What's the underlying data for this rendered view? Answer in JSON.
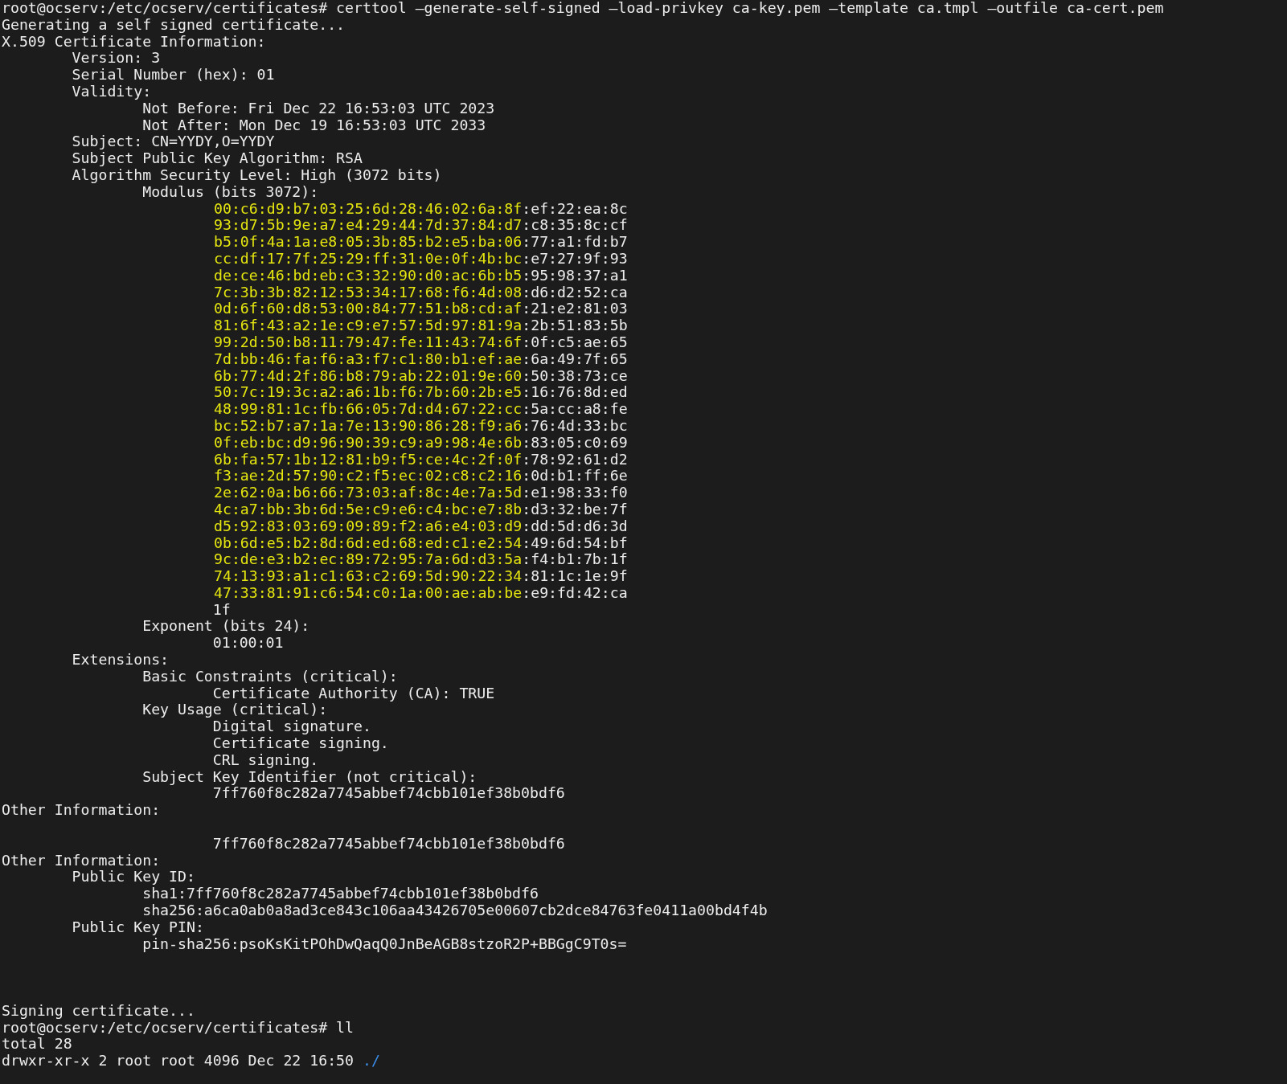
{
  "terminal": {
    "lines": [
      {
        "kind": "command",
        "text": "root@ocserv:/etc/ocserv/certificates# certtool —generate-self-signed —load-privkey ca-key.pem —template ca.tmpl —outfile ca-cert.pem"
      },
      {
        "kind": "output",
        "text": "Generating a self signed certificate..."
      },
      {
        "kind": "output",
        "text": "X.509 Certificate Information:"
      },
      {
        "kind": "output",
        "text": "\tVersion: 3"
      },
      {
        "kind": "output",
        "text": "\tSerial Number (hex): 01"
      },
      {
        "kind": "output",
        "text": "\tValidity:"
      },
      {
        "kind": "output",
        "text": "\t\tNot Before: Fri Dec 22 16:53:03 UTC 2023"
      },
      {
        "kind": "output",
        "text": "\t\tNot After: Mon Dec 19 16:53:03 UTC 2033"
      },
      {
        "kind": "output",
        "text": "\tSubject: CN=YYDY,O=YYDY"
      },
      {
        "kind": "output",
        "text": "\tSubject Public Key Algorithm: RSA"
      },
      {
        "kind": "output",
        "text": "\tAlgorithm Security Level: High (3072 bits)"
      },
      {
        "kind": "output",
        "text": "\t\tModulus (bits 3072):"
      },
      {
        "kind": "hex",
        "highlighted": "00:c6:d9:b7:03:25:6d:28:46:02:6a:8f",
        "rest": ":ef:22:ea:8c"
      },
      {
        "kind": "hex",
        "highlighted": "93:d7:5b:9e:a7:e4:29:44:7d:37:84:d7",
        "rest": ":c8:35:8c:cf"
      },
      {
        "kind": "hex",
        "highlighted": "b5:0f:4a:1a:e8:05:3b:85:b2:e5:ba:06",
        "rest": ":77:a1:fd:b7"
      },
      {
        "kind": "hex",
        "highlighted": "cc:df:17:7f:25:29:ff:31:0e:0f:4b:bc",
        "rest": ":e7:27:9f:93"
      },
      {
        "kind": "hex",
        "highlighted": "de:ce:46:bd:eb:c3:32:90:d0:ac:6b:b5",
        "rest": ":95:98:37:a1"
      },
      {
        "kind": "hex",
        "highlighted": "7c:3b:3b:82:12:53:34:17:68:f6:4d:08",
        "rest": ":d6:d2:52:ca"
      },
      {
        "kind": "hex",
        "highlighted": "0d:6f:60:d8:53:00:84:77:51:b8:cd:af",
        "rest": ":21:e2:81:03"
      },
      {
        "kind": "hex",
        "highlighted": "81:6f:43:a2:1e:c9:e7:57:5d:97:81:9a",
        "rest": ":2b:51:83:5b"
      },
      {
        "kind": "hex",
        "highlighted": "99:2d:50:b8:11:79:47:fe:11:43:74:6f",
        "rest": ":0f:c5:ae:65"
      },
      {
        "kind": "hex",
        "highlighted": "7d:bb:46:fa:f6:a3:f7:c1:80:b1:ef:ae",
        "rest": ":6a:49:7f:65"
      },
      {
        "kind": "hex",
        "highlighted": "6b:77:4d:2f:86:b8:79:ab:22:01:9e:60",
        "rest": ":50:38:73:ce"
      },
      {
        "kind": "hex",
        "highlighted": "50:7c:19:3c:a2:a6:1b:f6:7b:60:2b:e5",
        "rest": ":16:76:8d:ed"
      },
      {
        "kind": "hex",
        "highlighted": "48:99:81:1c:fb:66:05:7d:d4:67:22:cc",
        "rest": ":5a:cc:a8:fe"
      },
      {
        "kind": "hex",
        "highlighted": "bc:52:b7:a7:1a:7e:13:90:86:28:f9:a6",
        "rest": ":76:4d:33:bc"
      },
      {
        "kind": "hex",
        "highlighted": "0f:eb:bc:d9:96:90:39:c9:a9:98:4e:6b",
        "rest": ":83:05:c0:69"
      },
      {
        "kind": "hex",
        "highlighted": "6b:fa:57:1b:12:81:b9:f5:ce:4c:2f:0f",
        "rest": ":78:92:61:d2"
      },
      {
        "kind": "hex",
        "highlighted": "f3:ae:2d:57:90:c2:f5:ec:02:c8:c2:16",
        "rest": ":0d:b1:ff:6e"
      },
      {
        "kind": "hex",
        "highlighted": "2e:62:0a:b6:66:73:03:af:8c:4e:7a:5d",
        "rest": ":e1:98:33:f0"
      },
      {
        "kind": "hex",
        "highlighted": "4c:a7:bb:3b:6d:5e:c9:e6:c4:bc:e7:8b",
        "rest": ":d3:32:be:7f"
      },
      {
        "kind": "hex",
        "highlighted": "d5:92:83:03:69:09:89:f2:a6:e4:03:d9",
        "rest": ":dd:5d:d6:3d"
      },
      {
        "kind": "hex",
        "highlighted": "0b:6d:e5:b2:8d:6d:ed:68:ed:c1:e2:54",
        "rest": ":49:6d:54:bf"
      },
      {
        "kind": "hex",
        "highlighted": "9c:de:e3:b2:ec:89:72:95:7a:6d:d3:5a",
        "rest": ":f4:b1:7b:1f"
      },
      {
        "kind": "hex",
        "highlighted": "74:13:93:a1:c1:63:c2:69:5d:90:22:34",
        "rest": ":81:1c:1e:9f"
      },
      {
        "kind": "hex",
        "highlighted": "47:33:81:91:c6:54:c0:1a:00:ae:ab:be",
        "rest": ":e9:fd:42:ca"
      },
      {
        "kind": "output",
        "text": "\t\t\t1f"
      },
      {
        "kind": "output",
        "text": "\t\tExponent (bits 24):"
      },
      {
        "kind": "output",
        "text": "\t\t\t01:00:01"
      },
      {
        "kind": "output",
        "text": "\tExtensions:"
      },
      {
        "kind": "output",
        "text": "\t\tBasic Constraints (critical):"
      },
      {
        "kind": "output",
        "text": "\t\t\tCertificate Authority (CA): TRUE"
      },
      {
        "kind": "output",
        "text": "\t\tKey Usage (critical):"
      },
      {
        "kind": "output",
        "text": "\t\t\tDigital signature."
      },
      {
        "kind": "output",
        "text": "\t\t\tCertificate signing."
      },
      {
        "kind": "output",
        "text": "\t\t\tCRL signing."
      },
      {
        "kind": "output",
        "text": "\t\tSubject Key Identifier (not critical):"
      },
      {
        "kind": "output",
        "text": "\t\t\t7ff760f8c282a7745abbef74cbb101ef38b0bdf6"
      },
      {
        "kind": "output",
        "text": "Other Information:"
      },
      {
        "kind": "blank"
      },
      {
        "kind": "output",
        "text": "\t\t\t7ff760f8c282a7745abbef74cbb101ef38b0bdf6"
      },
      {
        "kind": "output",
        "text": "Other Information:"
      },
      {
        "kind": "output",
        "text": "\tPublic Key ID:"
      },
      {
        "kind": "output",
        "text": "\t\tsha1:7ff760f8c282a7745abbef74cbb101ef38b0bdf6"
      },
      {
        "kind": "output",
        "text": "\t\tsha256:a6ca0ab0a8ad3ce843c106aa43426705e00607cb2dce84763fe0411a00bd4f4b"
      },
      {
        "kind": "output",
        "text": "\tPublic Key PIN:"
      },
      {
        "kind": "output",
        "text": "\t\tpin-sha256:psoKsKitPOhDwQaqQ0JnBeAGB8stzoR2P+BBGgC9T0s="
      },
      {
        "kind": "blank"
      },
      {
        "kind": "blank"
      },
      {
        "kind": "blank"
      },
      {
        "kind": "output",
        "text": "Signing certificate..."
      },
      {
        "kind": "command",
        "text": "root@ocserv:/etc/ocserv/certificates# ll"
      },
      {
        "kind": "output",
        "text": "total 28"
      },
      {
        "kind": "listing",
        "text": "drwxr-xr-x 2 root root 4096 Dec 22 16:50 ",
        "entry": "./"
      }
    ]
  }
}
